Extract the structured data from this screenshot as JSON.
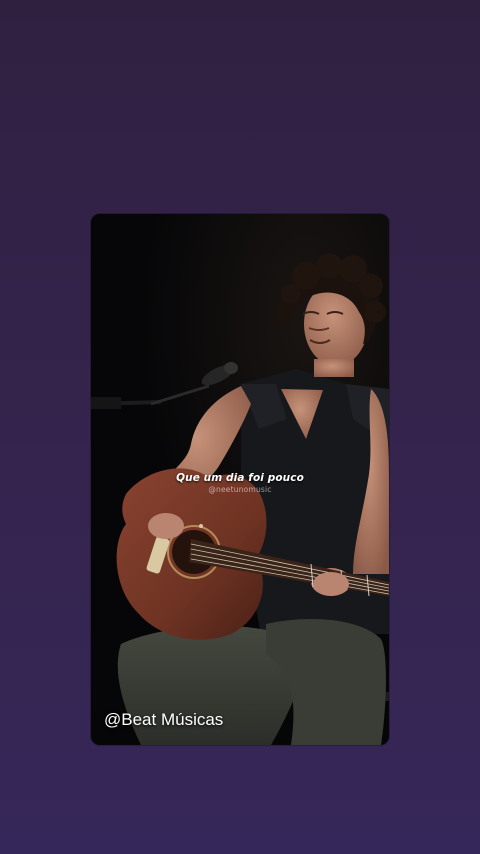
{
  "story": {
    "lyric": "Que um dia foi pouco",
    "credit": "@neetunomusic",
    "watermark": "@Beat Músicas"
  },
  "colors": {
    "background_top": "#302040",
    "background_bottom": "#36275a",
    "stage_black": "#070709",
    "guitar_wood": "#6e3323",
    "caption_text": "#ffffff"
  }
}
